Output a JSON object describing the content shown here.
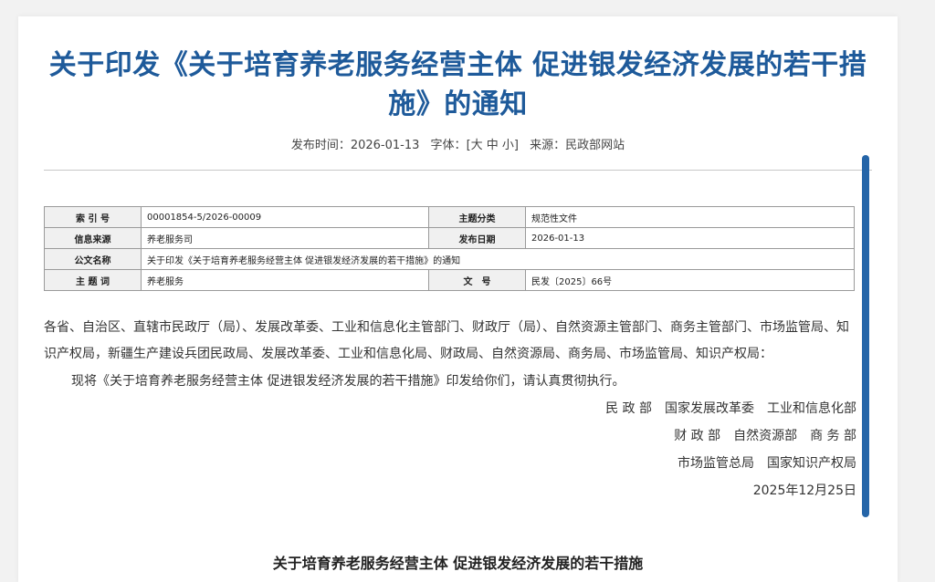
{
  "title": "关于印发《关于培育养老服务经营主体 促进银发经济发展的若干措施》的通知",
  "meta": {
    "publish_label": "发布时间：",
    "publish_date": "2026-01-13",
    "font_label": "字体：",
    "font_sizes": "[大 中 小]",
    "source_label": "来源：",
    "source": "民政部网站"
  },
  "info_table": {
    "index_label": "索 引 号",
    "index_value": "00001854-5/2026-00009",
    "topic_label": "主题分类",
    "topic_value": "规范性文件",
    "origin_label": "信息来源",
    "origin_value": "养老服务司",
    "date_label": "发布日期",
    "date_value": "2026-01-13",
    "doc_name_label": "公文名称",
    "doc_name_value": "关于印发《关于培育养老服务经营主体 促进银发经济发展的若干措施》的通知",
    "keyword_label": "主 题 词",
    "keyword_value": "养老服务",
    "docno_label": "文　号",
    "docno_value": "民发〔2025〕66号"
  },
  "body": {
    "addressees": "各省、自治区、直辖市民政厅（局）、发展改革委、工业和信息化主管部门、财政厅（局）、自然资源主管部门、商务主管部门、市场监管局、知识产权局，新疆生产建设兵团民政局、发展改革委、工业和信息化局、财政局、自然资源局、商务局、市场监管局、知识产权局：",
    "paragraph": "现将《关于培育养老服务经营主体 促进银发经济发展的若干措施》印发给你们，请认真贯彻执行。",
    "signatures": [
      "民 政 部　国家发展改革委　工业和信息化部",
      "财 政 部　自然资源部　商 务 部",
      "市场监管总局　国家知识产权局"
    ],
    "date": "2025年12月25日"
  },
  "subtitle": "关于培育养老服务经营主体  促进银发经济发展的若干措施",
  "colors": {
    "title": "#1e5a9a",
    "scrollbar": "#2565a8",
    "table_header_bg": "#f0f0f0"
  }
}
